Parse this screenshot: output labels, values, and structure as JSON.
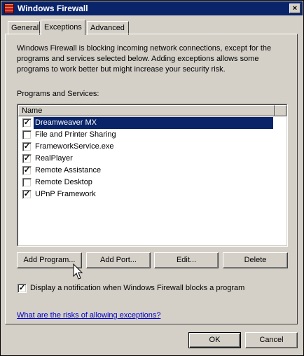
{
  "window": {
    "title": "Windows Firewall",
    "close_label": "×"
  },
  "tabs": [
    {
      "label": "General",
      "active": false
    },
    {
      "label": "Exceptions",
      "active": true
    },
    {
      "label": "Advanced",
      "active": false
    }
  ],
  "exceptions": {
    "description": "Windows Firewall is blocking incoming network connections, except for the programs and services selected below. Adding exceptions allows some programs to work better but might increase your security risk.",
    "list_label": "Programs and Services:",
    "column_header": "Name",
    "items": [
      {
        "label": "Dreamweaver MX",
        "checked": true,
        "selected": true
      },
      {
        "label": "File and Printer Sharing",
        "checked": false,
        "selected": false
      },
      {
        "label": "FrameworkService.exe",
        "checked": true,
        "selected": false
      },
      {
        "label": "RealPlayer",
        "checked": true,
        "selected": false
      },
      {
        "label": "Remote Assistance",
        "checked": true,
        "selected": false
      },
      {
        "label": "Remote Desktop",
        "checked": false,
        "selected": false
      },
      {
        "label": "UPnP Framework",
        "checked": true,
        "selected": false
      }
    ],
    "buttons": {
      "add_program": "Add Program...",
      "add_port": "Add Port...",
      "edit": "Edit...",
      "delete": "Delete"
    },
    "notification": {
      "label": "Display a notification when Windows Firewall blocks a program",
      "checked": true
    },
    "risk_link": "What are the risks of allowing exceptions?"
  },
  "footer": {
    "ok": "OK",
    "cancel": "Cancel"
  },
  "check_glyph": "✓"
}
